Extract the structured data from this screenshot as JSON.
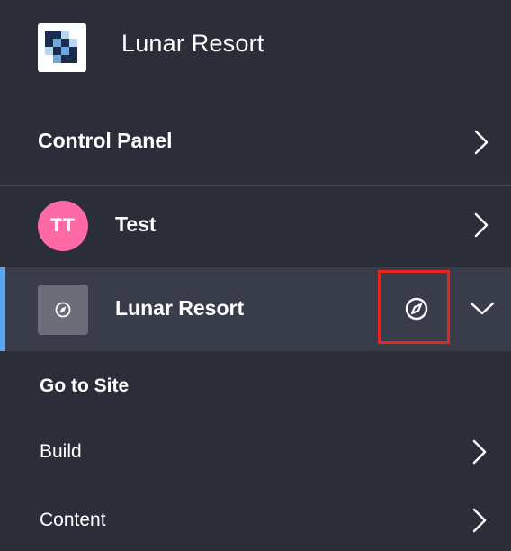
{
  "header": {
    "title": "Lunar Resort",
    "logo_icon": "site-logo-icon"
  },
  "control_panel": {
    "label": "Control Panel"
  },
  "user": {
    "initials": "TT",
    "name": "Test",
    "avatar_color": "#ff69a5"
  },
  "site": {
    "name": "Lunar Resort",
    "accent_color": "#5aa4f2",
    "highlight_color": "#e4261f"
  },
  "menu": {
    "go_to_site": "Go to Site",
    "build": "Build",
    "content": "Content"
  }
}
